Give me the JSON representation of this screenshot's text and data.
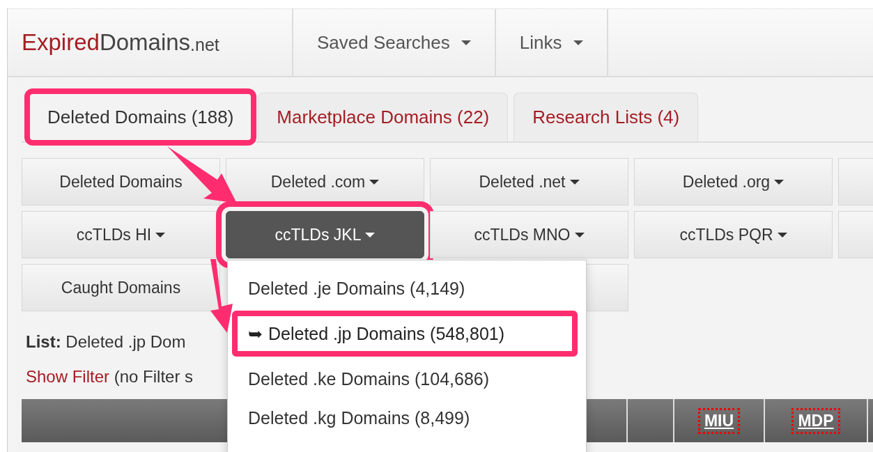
{
  "brand": {
    "name_a": "Expired",
    "name_b": "Domains",
    "suffix": ".net"
  },
  "nav": [
    {
      "label": "Saved Searches",
      "dropdown": true
    },
    {
      "label": "Links",
      "dropdown": true
    }
  ],
  "tabs": [
    {
      "label": "Deleted Domains (188)",
      "selected": true,
      "highlighted": true
    },
    {
      "label": "Marketplace Domains (22)",
      "selected": false,
      "highlighted": false
    },
    {
      "label": "Research Lists (4)",
      "selected": false,
      "highlighted": false
    }
  ],
  "button_rows": [
    [
      {
        "kind": "button",
        "label": "Deleted Domains",
        "dropdown": false,
        "selected": false,
        "highlighted": false
      },
      {
        "kind": "button",
        "label": "Deleted .com",
        "dropdown": true,
        "selected": false,
        "highlighted": false
      },
      {
        "kind": "button",
        "label": "Deleted .net",
        "dropdown": true,
        "selected": false,
        "highlighted": false
      },
      {
        "kind": "button",
        "label": "Deleted .org",
        "dropdown": true,
        "selected": false,
        "highlighted": false
      },
      {
        "kind": "blank"
      }
    ],
    [
      {
        "kind": "button",
        "label": "ccTLDs HI",
        "dropdown": true,
        "selected": false,
        "highlighted": false
      },
      {
        "kind": "button",
        "label": "ccTLDs JKL",
        "dropdown": true,
        "selected": true,
        "highlighted": true
      },
      {
        "kind": "button",
        "label": "ccTLDs MNO",
        "dropdown": true,
        "selected": false,
        "highlighted": false
      },
      {
        "kind": "button",
        "label": "ccTLDs PQR",
        "dropdown": true,
        "selected": false,
        "highlighted": false
      },
      {
        "kind": "blank"
      }
    ],
    [
      {
        "kind": "button",
        "label": "Caught Domains",
        "dropdown": false,
        "selected": false,
        "highlighted": false
      },
      {
        "kind": "spacer"
      },
      {
        "kind": "blank"
      }
    ]
  ],
  "list": {
    "label": "List:",
    "value": "Deleted .jp Dom"
  },
  "filter": {
    "link": "Show Filter",
    "note": "(no Filter s"
  },
  "table": {
    "columns": [
      {
        "kind": "blank"
      },
      {
        "kind": "blank"
      },
      {
        "kind": "sort",
        "label": "MIU"
      },
      {
        "kind": "sort",
        "label": "MDP"
      }
    ]
  },
  "menu": [
    {
      "label": "Deleted .je Domains (4,149)",
      "selected": false,
      "highlighted": false
    },
    {
      "marker": "➥",
      "label": "Deleted .jp Domains (548,801)",
      "selected": true,
      "highlighted": true
    },
    {
      "label": "Deleted .ke Domains (104,686)",
      "selected": false,
      "highlighted": false
    },
    {
      "label": "Deleted .kg Domains (8,499)",
      "selected": false,
      "highlighted": false
    }
  ]
}
